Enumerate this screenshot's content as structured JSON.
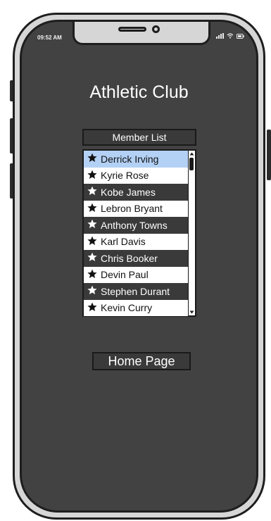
{
  "status_bar": {
    "time": "09:52 AM",
    "icons": [
      "signal-icon",
      "wifi-icon",
      "battery-icon"
    ]
  },
  "title": "Athletic Club",
  "member_list": {
    "header": "Member List",
    "items": [
      {
        "name": "Derrick Irving",
        "icon": "star-icon",
        "selected": true
      },
      {
        "name": "Kyrie Rose",
        "icon": "star-icon"
      },
      {
        "name": "Kobe James",
        "icon": "star-icon"
      },
      {
        "name": "Lebron Bryant",
        "icon": "star-icon"
      },
      {
        "name": "Anthony Towns",
        "icon": "star-icon"
      },
      {
        "name": "Karl Davis",
        "icon": "star-icon"
      },
      {
        "name": "Chris Booker",
        "icon": "star-icon"
      },
      {
        "name": "Devin Paul",
        "icon": "star-icon"
      },
      {
        "name": "Stephen Durant",
        "icon": "star-icon"
      },
      {
        "name": "Kevin Curry",
        "icon": "star-icon"
      }
    ]
  },
  "home_button": {
    "label": "Home Page"
  },
  "colors": {
    "screen": "#424242",
    "frame": "#d6d6d6",
    "selected_row": "#b3d1f5",
    "dark_row": "#3a3a3a"
  }
}
